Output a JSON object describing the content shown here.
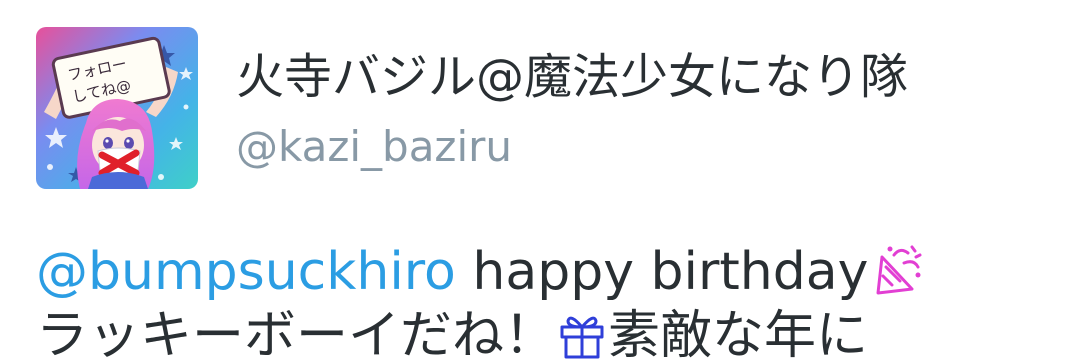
{
  "tweet": {
    "author": {
      "avatar_sign_text": [
        "フォロー",
        "してね@"
      ],
      "display_name": "火寺バジル@魔法少女になり隊",
      "handle": "@kazi_baziru"
    },
    "body": {
      "mention": "@bumpsuckhiro",
      "line1_text": " happy birthday",
      "line1_emoji": "party-popper-icon",
      "line2_text_a": "ラッキーボーイだね！",
      "line2_emoji": "gift-icon",
      "line2_text_b": "素敵な年に"
    },
    "colors": {
      "mention": "#2b9de3",
      "text": "#292f33",
      "secondary": "#8899a6",
      "party_popper": "#e23fd3",
      "gift": "#2f3fd9"
    }
  }
}
